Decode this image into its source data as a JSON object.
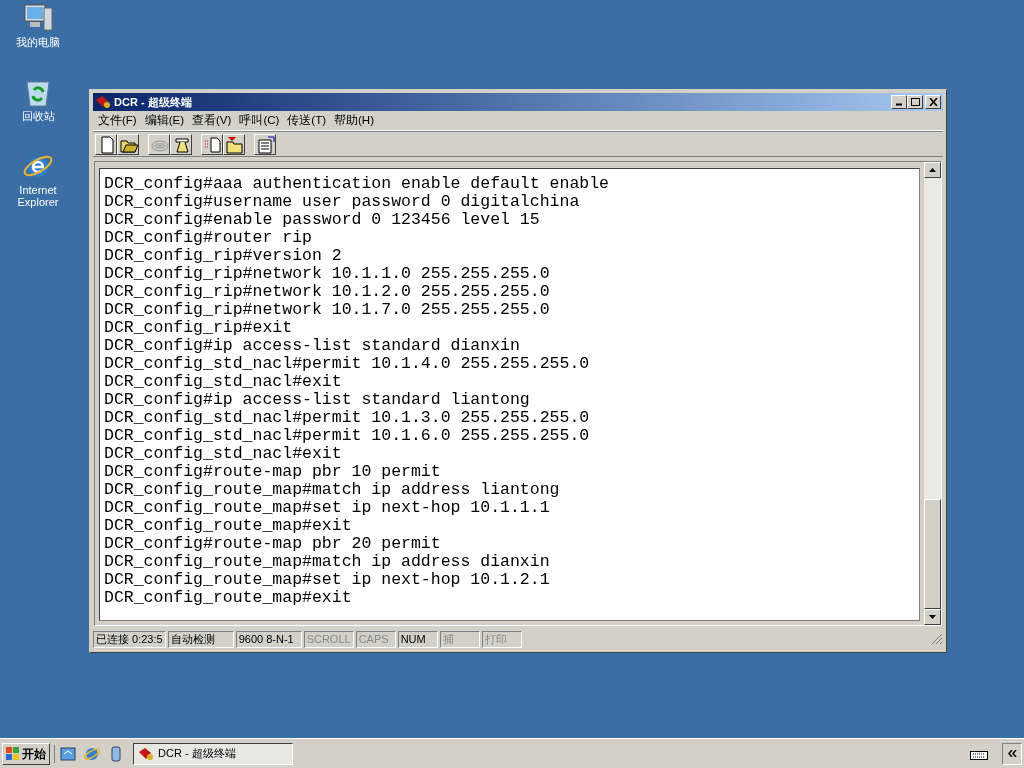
{
  "desktop_icons": [
    {
      "kind": "computer",
      "label": "我的电脑"
    },
    {
      "kind": "recycle",
      "label": "回收站"
    },
    {
      "kind": "browser",
      "label": "Internet Explorer"
    }
  ],
  "window": {
    "title": "DCR - 超级终端"
  },
  "menu": [
    "文件(F)",
    "编辑(E)",
    "查看(V)",
    "呼叫(C)",
    "传送(T)",
    "帮助(H)"
  ],
  "toolbar": [
    {
      "kind": "new",
      "disabled": false
    },
    {
      "kind": "open",
      "disabled": false
    },
    {
      "kind": "gap"
    },
    {
      "kind": "disconnect",
      "disabled": true
    },
    {
      "kind": "call",
      "disabled": false
    },
    {
      "kind": "gap"
    },
    {
      "kind": "send",
      "disabled": false
    },
    {
      "kind": "receive",
      "disabled": false
    },
    {
      "kind": "gap"
    },
    {
      "kind": "properties",
      "disabled": false
    }
  ],
  "terminal_lines": [
    "DCR_config#aaa authentication enable default enable",
    "DCR_config#username user password 0 digitalchina",
    "DCR_config#enable password 0 123456 level 15",
    "DCR_config#router rip",
    "DCR_config_rip#version 2",
    "DCR_config_rip#network 10.1.1.0 255.255.255.0",
    "DCR_config_rip#network 10.1.2.0 255.255.255.0",
    "DCR_config_rip#network 10.1.7.0 255.255.255.0",
    "DCR_config_rip#exit",
    "DCR_config#ip access-list standard dianxin",
    "DCR_config_std_nacl#permit 10.1.4.0 255.255.255.0",
    "DCR_config_std_nacl#exit",
    "DCR_config#ip access-list standard liantong",
    "DCR_config_std_nacl#permit 10.1.3.0 255.255.255.0",
    "DCR_config_std_nacl#permit 10.1.6.0 255.255.255.0",
    "DCR_config_std_nacl#exit",
    "DCR_config#route-map pbr 10 permit",
    "DCR_config_route_map#match ip address liantong",
    "DCR_config_route_map#set ip next-hop 10.1.1.1",
    "DCR_config_route_map#exit",
    "DCR_config#route-map pbr 20 permit",
    "DCR_config_route_map#match ip address dianxin",
    "DCR_config_route_map#set ip next-hop 10.1.2.1",
    "DCR_config_route_map#exit"
  ],
  "status_bar": [
    {
      "text": "已连接 0:23:5",
      "on": true
    },
    {
      "text": "自动检测",
      "on": true
    },
    {
      "text": "9600 8-N-1",
      "on": true
    },
    {
      "text": "SCROLL",
      "on": false
    },
    {
      "text": "CAPS",
      "on": false
    },
    {
      "text": "NUM",
      "on": true
    },
    {
      "text": "捕",
      "on": false
    },
    {
      "text": "打印",
      "on": false
    }
  ],
  "taskbar": {
    "start": "开始",
    "quick_launch": [
      {
        "kind": "desktop"
      },
      {
        "kind": "browser"
      },
      {
        "kind": "app"
      }
    ],
    "tasks": [
      {
        "label": "DCR - 超级终端",
        "selected": true
      }
    ]
  }
}
